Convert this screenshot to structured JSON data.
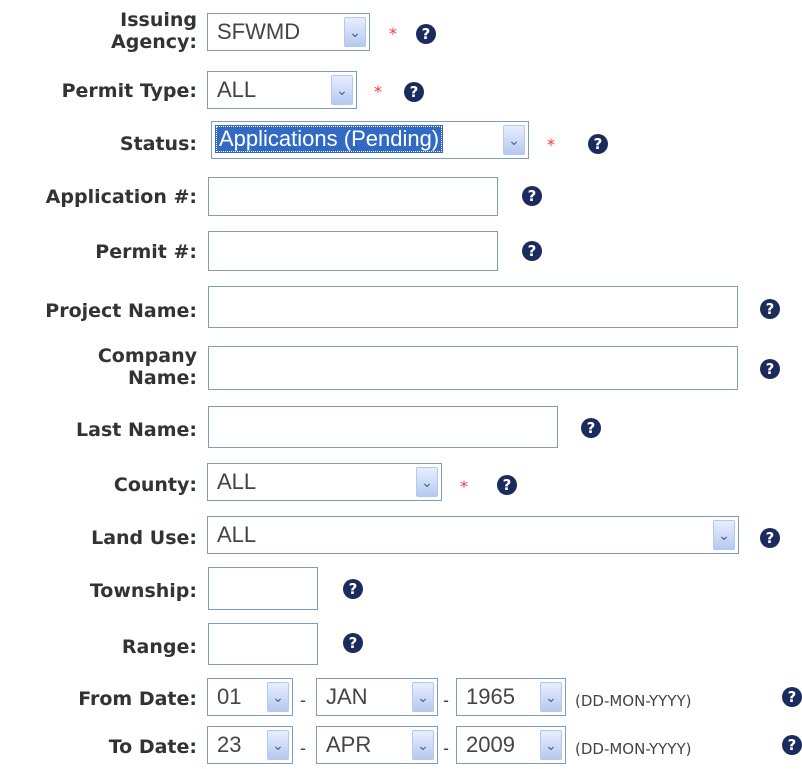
{
  "form": {
    "issuing_agency": {
      "label_line1": "Issuing",
      "label_line2": "Agency:",
      "value": "SFWMD",
      "required_mark": "*"
    },
    "permit_type": {
      "label": "Permit Type:",
      "value": "ALL",
      "required_mark": "*"
    },
    "status": {
      "label": "Status:",
      "value": "Applications (Pending)",
      "required_mark": "*"
    },
    "application_number": {
      "label": "Application #:",
      "value": ""
    },
    "permit_number": {
      "label": "Permit #:",
      "value": ""
    },
    "project_name": {
      "label": "Project Name:",
      "value": ""
    },
    "company_name": {
      "label_line1": "Company",
      "label_line2": "Name:",
      "value": ""
    },
    "last_name": {
      "label": "Last Name:",
      "value": ""
    },
    "county": {
      "label": "County:",
      "value": "ALL",
      "required_mark": "*"
    },
    "land_use": {
      "label": "Land Use:",
      "value": "ALL"
    },
    "township": {
      "label": "Township:",
      "value": ""
    },
    "range": {
      "label": "Range:",
      "value": ""
    },
    "from_date": {
      "label": "From Date:",
      "day": "01",
      "month": "JAN",
      "year": "1965",
      "format_hint": "(DD-MON-YYYY)"
    },
    "to_date": {
      "label": "To Date:",
      "day": "23",
      "month": "APR",
      "year": "2009",
      "format_hint": "(DD-MON-YYYY)"
    }
  },
  "ui": {
    "help_glyph": "?",
    "dropdown_glyph": "⌄",
    "date_separator": "-"
  },
  "colors": {
    "label_text": "#333333",
    "required_asterisk": "#ff3333",
    "help_icon_bg": "#1c2b5e",
    "input_border": "#7f9db9",
    "selected_highlight": "#316ac5"
  }
}
